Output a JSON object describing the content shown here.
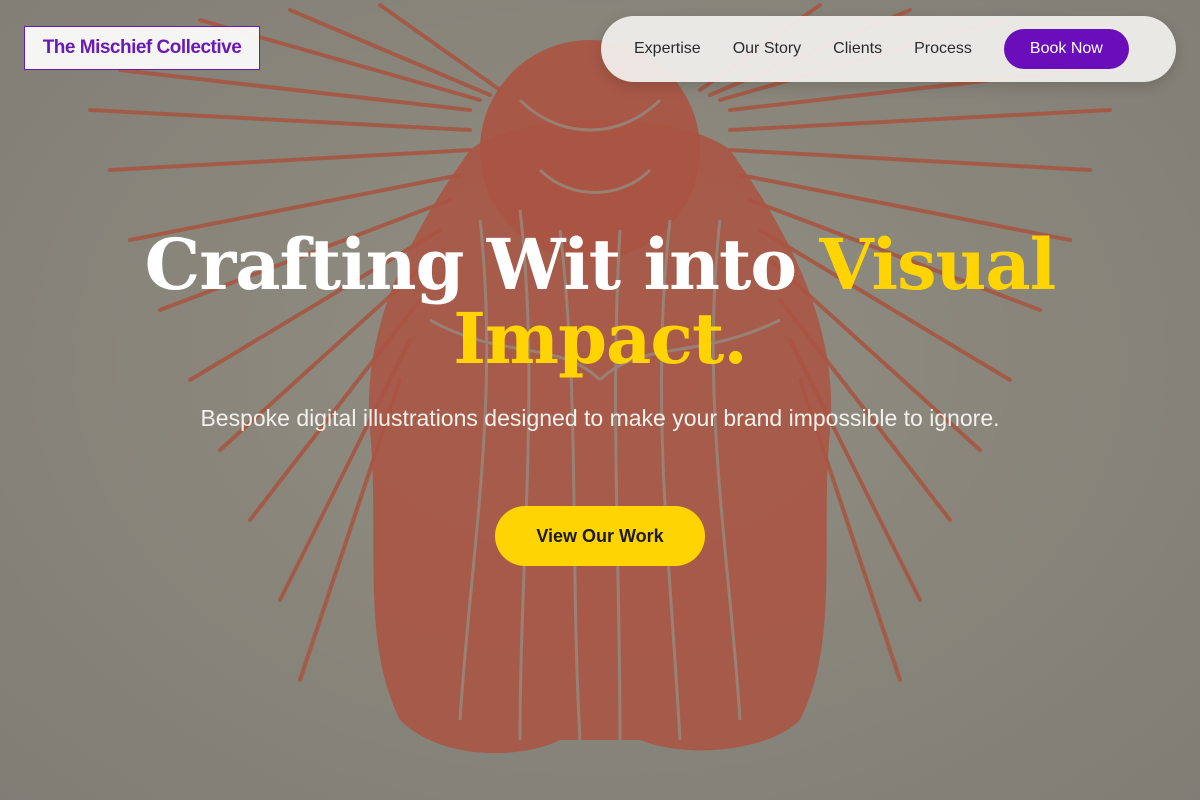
{
  "brand": {
    "name": "The Mischief Collective"
  },
  "nav": {
    "links": [
      "Expertise",
      "Our Story",
      "Clients",
      "Process"
    ],
    "cta_label": "Book Now"
  },
  "hero": {
    "headline_part1": "Crafting Wit into",
    "headline_accent_line1": "Visual",
    "headline_accent_line2": "Impact.",
    "subtitle": "Bespoke digital illustrations designed to make your brand impossible to ignore.",
    "cta_label": "View Our Work"
  },
  "colors": {
    "brand_purple": "#6a0dbb",
    "accent_yellow": "#ffd400",
    "illustration_red": "#b8503c",
    "background_gray": "#8f8c80"
  }
}
